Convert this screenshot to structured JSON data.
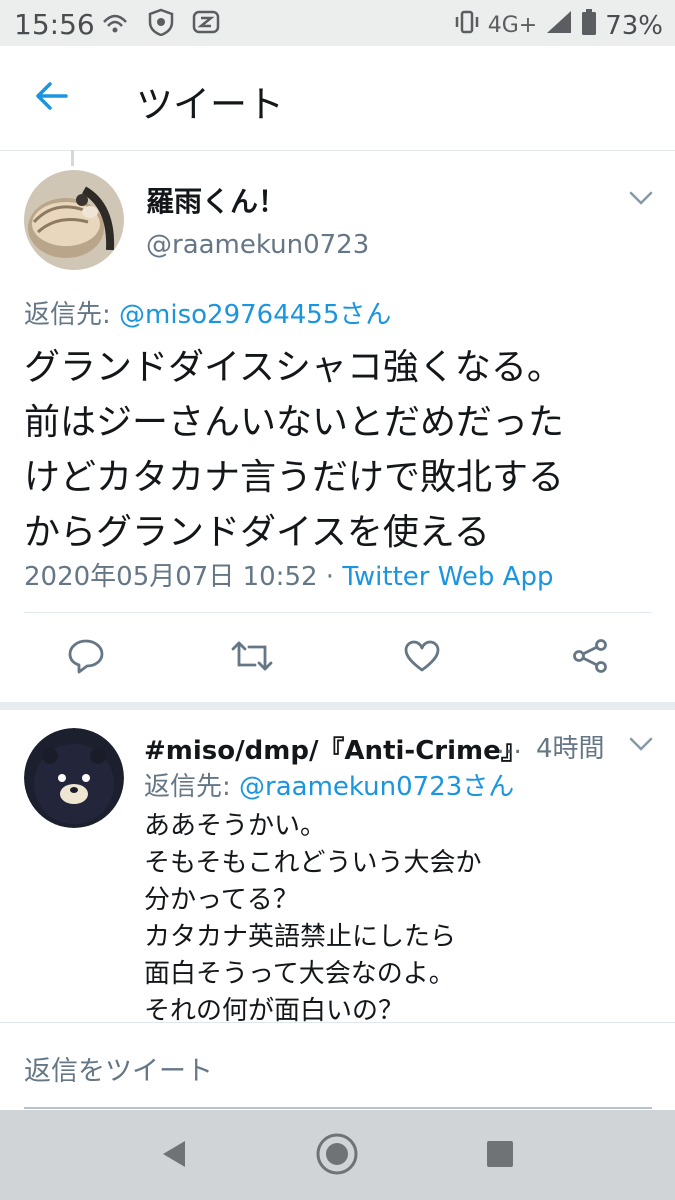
{
  "status_bar": {
    "time": "15:56",
    "network": "4G+",
    "battery": "73%"
  },
  "header": {
    "title": "ツイート"
  },
  "main_tweet": {
    "display_name": "羅雨くん！",
    "handle": "@raamekun0723",
    "reply_label": "返信先: ",
    "reply_mention": "@miso29764455さん",
    "text": "グランドダイスシャコ強くなる。\n前はジーさんいないとだめだった\nけどカタカナ言うだけで敗北する\nからグランドダイスを使える",
    "timestamp": "2020年05月07日 10:52 · ",
    "source": "Twitter Web App"
  },
  "reply_tweet": {
    "display_name": "#miso/dmp/『Anti-Crime』",
    "ellipsis": "…",
    "time": "4時間",
    "reply_label": "返信先: ",
    "reply_mention": "@raamekun0723さん",
    "text": "ああそうかい。\nそもそもこれどういう大会か\n分かってる？\nカタカナ英語禁止にしたら\n面白そうって大会なのよ。\nそれの何が面白いの？"
  },
  "compose": {
    "placeholder": "返信をツイート"
  },
  "colors": {
    "accent": "#1b95e0",
    "secondary_text": "#657786",
    "primary_text": "#14171a"
  },
  "icons": [
    "back-arrow-icon",
    "chevron-down-icon",
    "reply-icon",
    "retweet-icon",
    "like-icon",
    "share-icon",
    "nav-back-icon",
    "nav-home-icon",
    "nav-recents-icon"
  ]
}
